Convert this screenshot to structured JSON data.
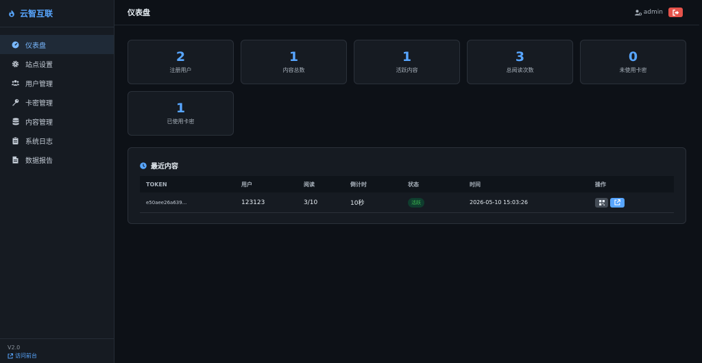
{
  "brand": {
    "name": "云智互联"
  },
  "sidebar": {
    "items": [
      {
        "label": "仪表盘",
        "icon": "gauge-icon"
      },
      {
        "label": "站点设置",
        "icon": "gear-icon"
      },
      {
        "label": "用户管理",
        "icon": "users-icon"
      },
      {
        "label": "卡密管理",
        "icon": "key-icon"
      },
      {
        "label": "内容管理",
        "icon": "database-icon"
      },
      {
        "label": "系统日志",
        "icon": "clipboard-icon"
      },
      {
        "label": "数据报告",
        "icon": "file-icon"
      }
    ],
    "active": 0
  },
  "footer": {
    "version": "V2.0",
    "front_link": "访问前台"
  },
  "header": {
    "title": "仪表盘",
    "user": "admin"
  },
  "stats": [
    {
      "value": "2",
      "label": "注册用户"
    },
    {
      "value": "1",
      "label": "内容总数"
    },
    {
      "value": "1",
      "label": "活跃内容"
    },
    {
      "value": "3",
      "label": "总阅读次数"
    },
    {
      "value": "0",
      "label": "未使用卡密"
    },
    {
      "value": "1",
      "label": "已使用卡密"
    }
  ],
  "recent": {
    "title": "最近内容",
    "columns": [
      "TOKEN",
      "用户",
      "阅读",
      "倒计时",
      "状态",
      "时间",
      "操作"
    ],
    "rows": [
      {
        "token": "e50aee26a639...",
        "user": "123123",
        "reads": "3/10",
        "countdown": "10秒",
        "status": "活跃",
        "time": "2026-05-10 15:03:26"
      }
    ]
  },
  "colors": {
    "accent": "#58a6ff",
    "danger": "#e5534b",
    "success": "#3fb950",
    "bg": "#0d1117",
    "panel": "#161b22"
  }
}
